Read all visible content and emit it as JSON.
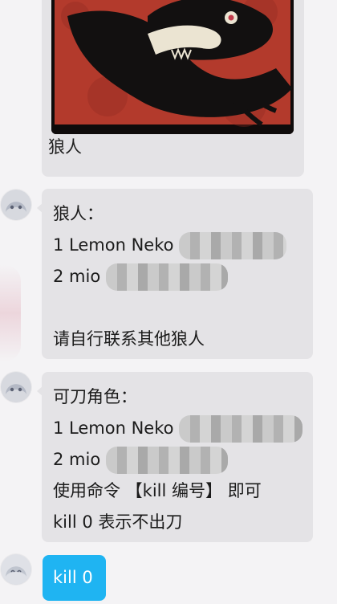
{
  "chat": {
    "image_message": {
      "image_name": "werewolf-card-image",
      "caption": "狼人"
    },
    "wolves_message": {
      "title": "狼人：",
      "line1_prefix": "1 Lemon Neko",
      "line2_prefix": "2 mio",
      "note": "请自行联系其他狼人"
    },
    "targets_message": {
      "title": "可刀角色：",
      "line1_prefix": "1 Lemon Neko",
      "line2_prefix": "2 mio",
      "line3": "使用命令 【kill 编号】 即可",
      "line4": "kill 0 表示不出刀"
    },
    "my_message": {
      "text": "kill 0"
    }
  },
  "colors": {
    "background": "#f4f3f5",
    "bubble_bg": "#e4e3e6",
    "my_bubble_bg": "#1fb4f2"
  }
}
